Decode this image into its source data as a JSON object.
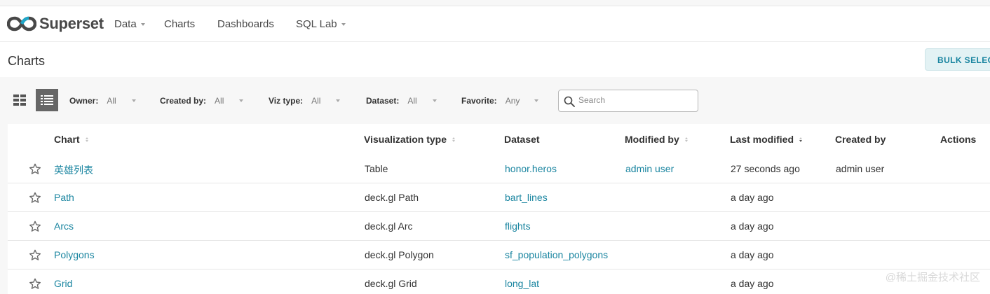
{
  "app": {
    "name": "Superset"
  },
  "nav": [
    {
      "label": "Data",
      "dropdown": true
    },
    {
      "label": "Charts",
      "dropdown": false
    },
    {
      "label": "Dashboards",
      "dropdown": false
    },
    {
      "label": "SQL Lab",
      "dropdown": true
    }
  ],
  "page": {
    "title": "Charts",
    "bulk_select_label": "BULK SELECT"
  },
  "filters": [
    {
      "label": "Owner:",
      "value": "All"
    },
    {
      "label": "Created by:",
      "value": "All"
    },
    {
      "label": "Viz type:",
      "value": "All"
    },
    {
      "label": "Dataset:",
      "value": "All"
    },
    {
      "label": "Favorite:",
      "value": "Any"
    }
  ],
  "search": {
    "placeholder": "Search",
    "value": ""
  },
  "table": {
    "columns": [
      "Chart",
      "Visualization type",
      "Dataset",
      "Modified by",
      "Last modified",
      "Created by",
      "Actions"
    ],
    "rows": [
      {
        "chart": "英雄列表",
        "viz_type": "Table",
        "dataset": "honor.heros",
        "modified_by": "admin user",
        "last_modified": "27 seconds ago",
        "created_by": "admin user"
      },
      {
        "chart": "Path",
        "viz_type": "deck.gl Path",
        "dataset": "bart_lines",
        "modified_by": "",
        "last_modified": "a day ago",
        "created_by": ""
      },
      {
        "chart": "Arcs",
        "viz_type": "deck.gl Arc",
        "dataset": "flights",
        "modified_by": "",
        "last_modified": "a day ago",
        "created_by": ""
      },
      {
        "chart": "Polygons",
        "viz_type": "deck.gl Polygon",
        "dataset": "sf_population_polygons",
        "modified_by": "",
        "last_modified": "a day ago",
        "created_by": ""
      },
      {
        "chart": "Grid",
        "viz_type": "deck.gl Grid",
        "dataset": "long_lat",
        "modified_by": "",
        "last_modified": "a day ago",
        "created_by": ""
      }
    ]
  },
  "watermark": "@稀土掘金技术社区",
  "colors": {
    "accent": "#1a85a0",
    "bulk_bg": "#e3f2f4",
    "logo": "#484848"
  }
}
